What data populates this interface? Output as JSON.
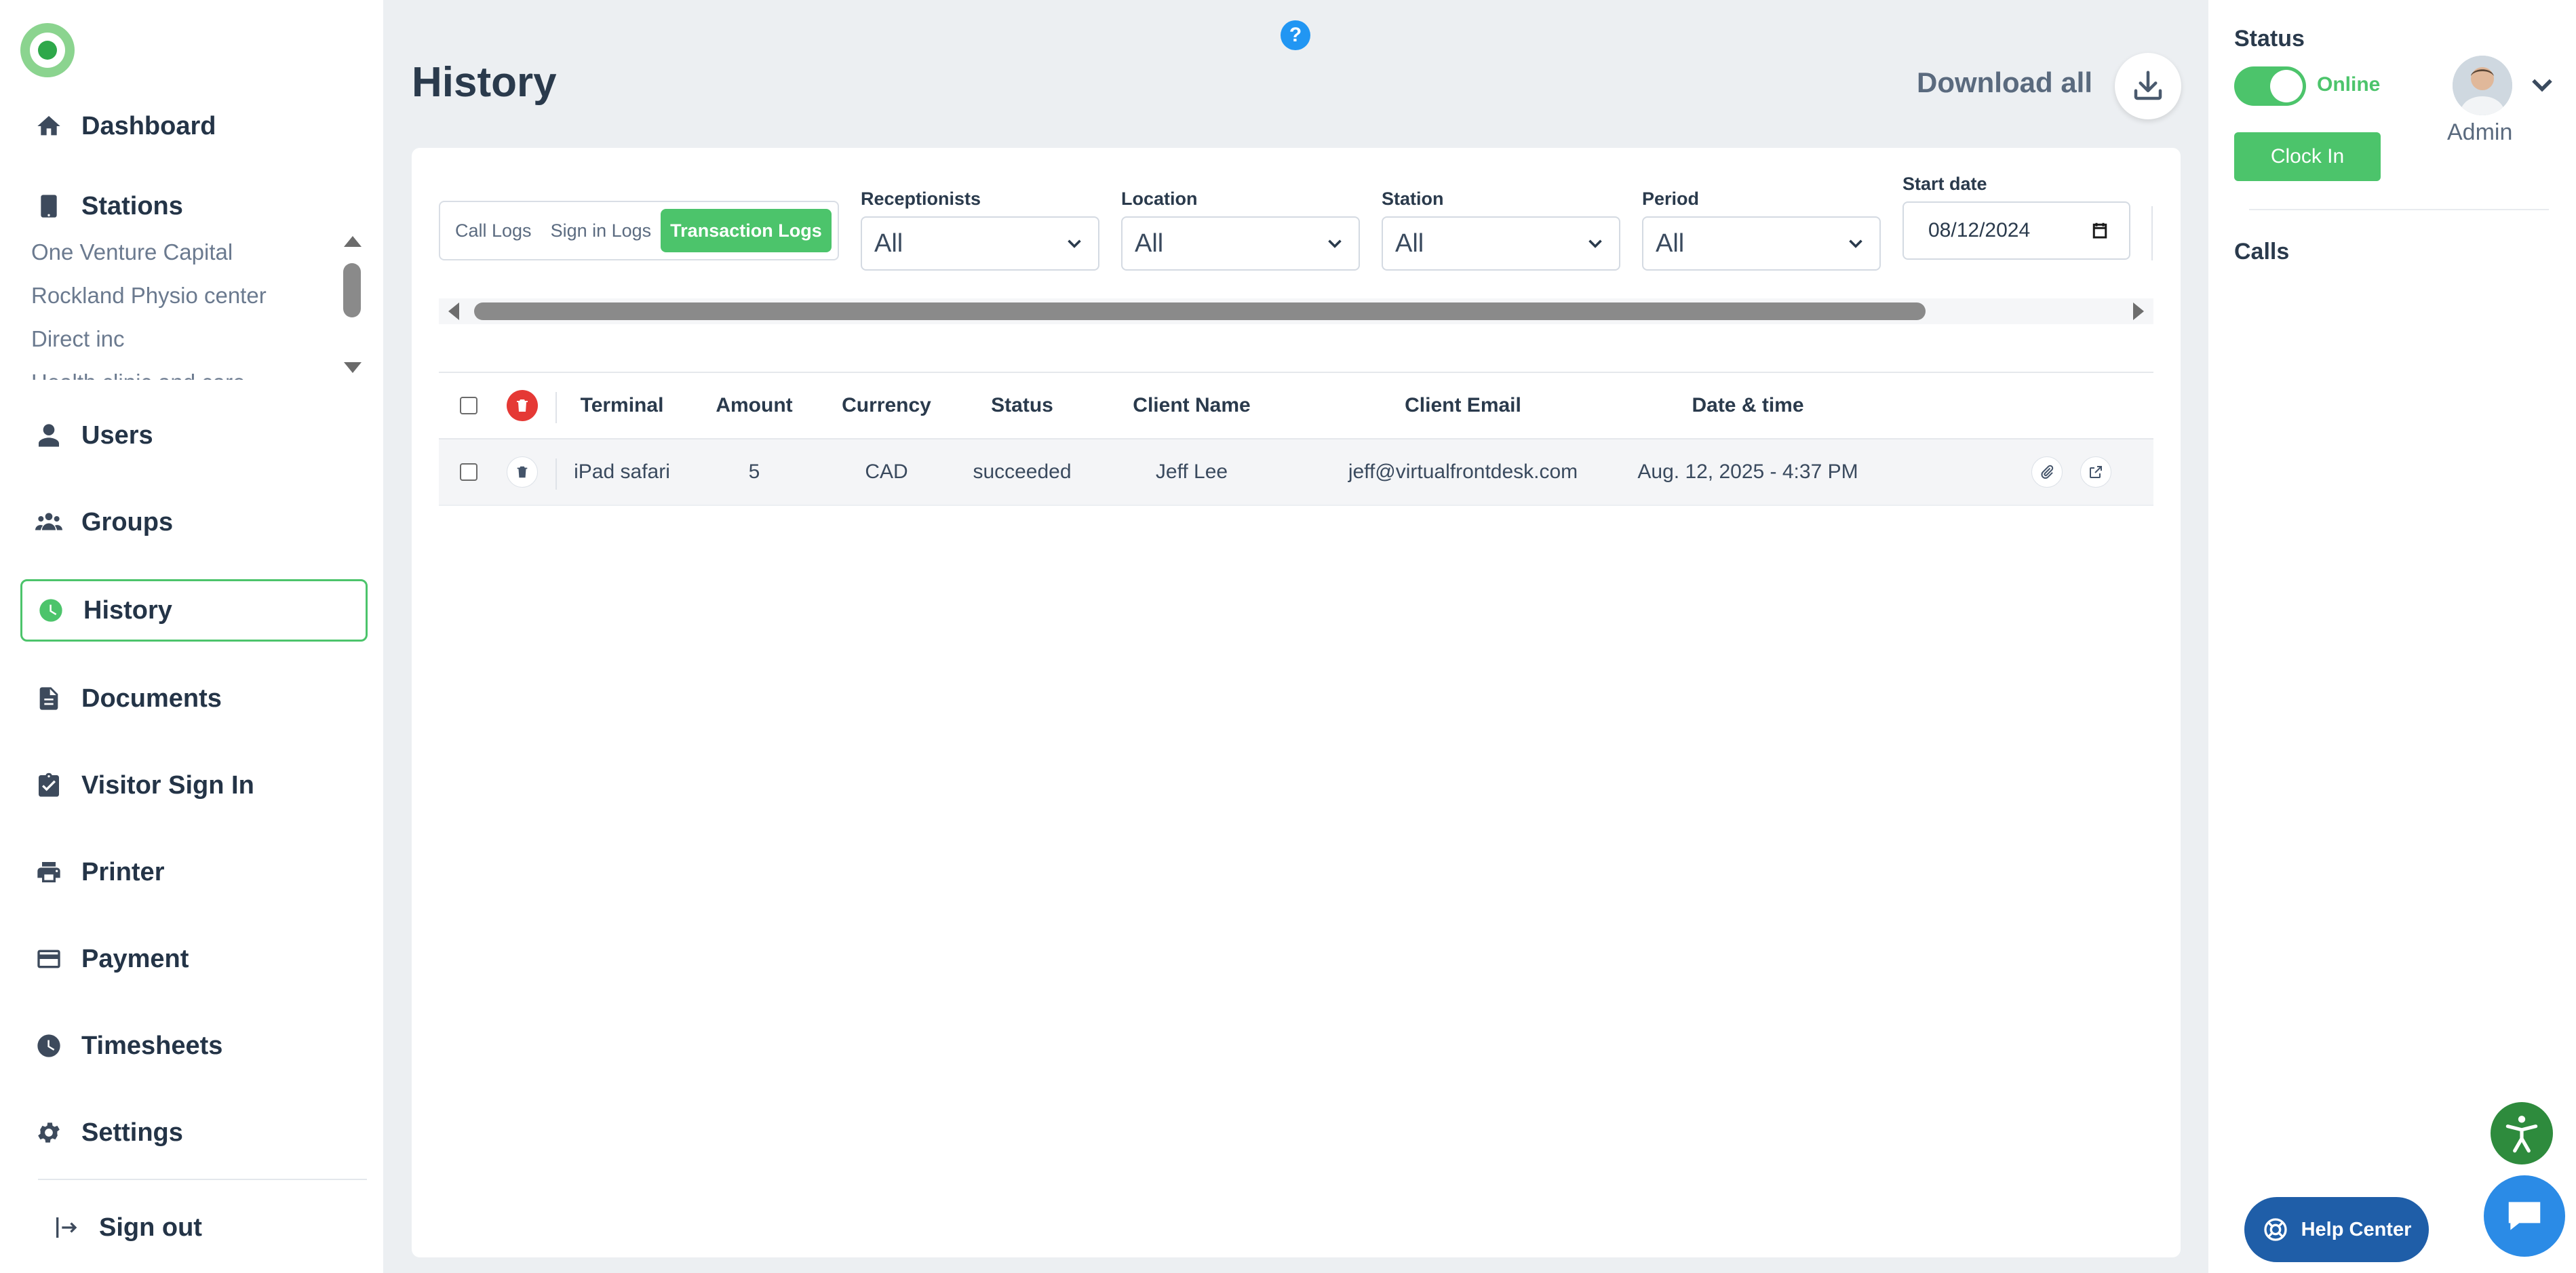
{
  "help_icon": "?",
  "sidebar": {
    "nav": [
      {
        "id": "dashboard",
        "label": "Dashboard",
        "icon": "home-icon"
      },
      {
        "id": "stations",
        "label": "Stations",
        "icon": "station-icon"
      },
      {
        "id": "users",
        "label": "Users",
        "icon": "user-icon"
      },
      {
        "id": "groups",
        "label": "Groups",
        "icon": "groups-icon"
      },
      {
        "id": "history",
        "label": "History",
        "icon": "clock-icon",
        "active": true
      },
      {
        "id": "documents",
        "label": "Documents",
        "icon": "document-icon"
      },
      {
        "id": "visitor_sign_in",
        "label": "Visitor Sign In",
        "icon": "clipboard-check-icon"
      },
      {
        "id": "printer",
        "label": "Printer",
        "icon": "printer-icon"
      },
      {
        "id": "payment",
        "label": "Payment",
        "icon": "credit-card-icon"
      },
      {
        "id": "timesheets",
        "label": "Timesheets",
        "icon": "clock-icon"
      },
      {
        "id": "settings",
        "label": "Settings",
        "icon": "gear-icon"
      }
    ],
    "stations": [
      "One Venture Capital",
      "Rockland Physio center",
      "Direct inc",
      "Health clinic and care"
    ],
    "sign_out": "Sign out"
  },
  "header": {
    "title": "History",
    "download_all": "Download all"
  },
  "filters": {
    "log_tabs": [
      {
        "label": "Call Logs",
        "active": false
      },
      {
        "label": "Sign in Logs",
        "active": false
      },
      {
        "label": "Transaction Logs",
        "active": true
      }
    ],
    "receptionists": {
      "label": "Receptionists",
      "value": "All"
    },
    "location": {
      "label": "Location",
      "value": "All"
    },
    "station": {
      "label": "Station",
      "value": "All"
    },
    "period": {
      "label": "Period",
      "value": "All"
    },
    "start_date": {
      "label": "Start date",
      "value": "08/12/2024"
    }
  },
  "table": {
    "columns": [
      "Terminal",
      "Amount",
      "Currency",
      "Status",
      "Client Name",
      "Client Email",
      "Date & time"
    ],
    "rows": [
      {
        "terminal": "iPad safari",
        "amount": "5",
        "currency": "CAD",
        "status": "succeeded",
        "client_name": "Jeff Lee",
        "client_email": "jeff@virtualfrontdesk.com",
        "datetime": "Aug. 12, 2025 - 4:37 PM"
      }
    ]
  },
  "right_panel": {
    "status_label": "Status",
    "online_label": "Online",
    "online": true,
    "clock_in": "Clock In",
    "user_role": "Admin",
    "calls_label": "Calls",
    "help_center": "Help Center"
  },
  "colors": {
    "accent": "#4cc46b",
    "danger": "#e53935",
    "help_blue": "#1f5ea8",
    "chat_blue": "#2b8be6"
  }
}
